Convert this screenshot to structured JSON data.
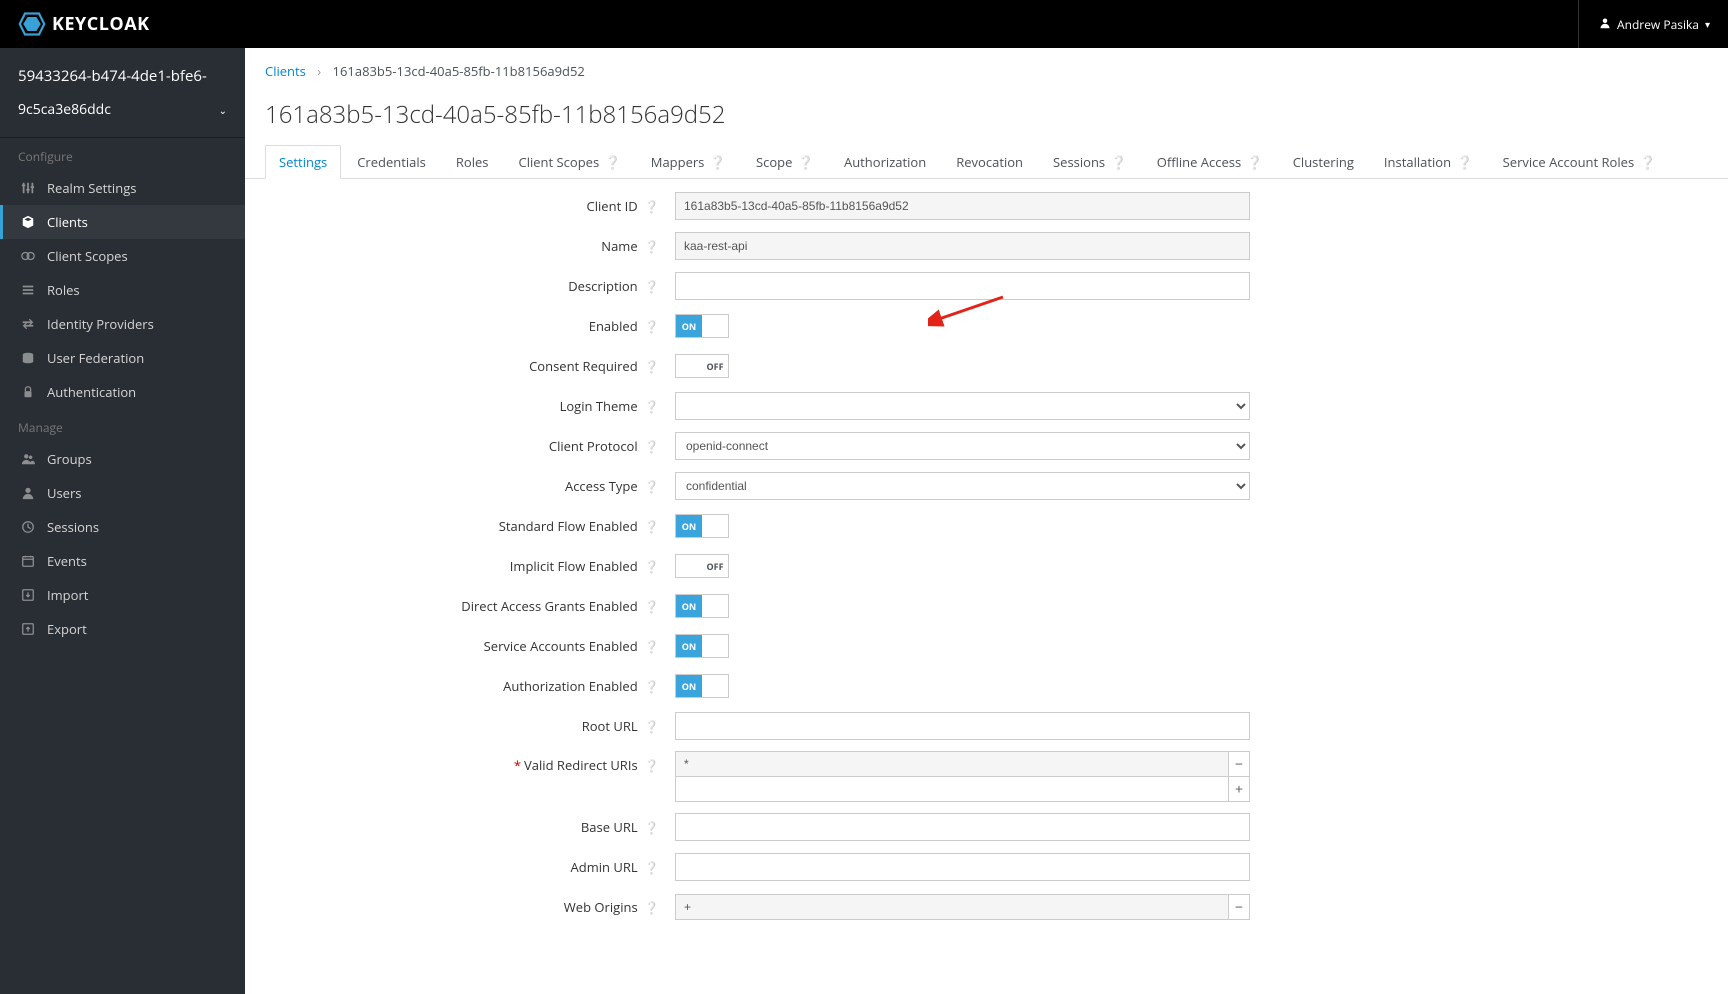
{
  "header": {
    "brand": "KEYCLOAK",
    "user": "Andrew Pasika"
  },
  "sidebar": {
    "realm_line1": "59433264-b474-4de1-bfe6-",
    "realm_selected": "9c5ca3e86ddc",
    "section_configure": "Configure",
    "section_manage": "Manage",
    "configure_items": [
      {
        "label": "Realm Settings"
      },
      {
        "label": "Clients"
      },
      {
        "label": "Client Scopes"
      },
      {
        "label": "Roles"
      },
      {
        "label": "Identity Providers"
      },
      {
        "label": "User Federation"
      },
      {
        "label": "Authentication"
      }
    ],
    "manage_items": [
      {
        "label": "Groups"
      },
      {
        "label": "Users"
      },
      {
        "label": "Sessions"
      },
      {
        "label": "Events"
      },
      {
        "label": "Import"
      },
      {
        "label": "Export"
      }
    ]
  },
  "breadcrumb": {
    "root": "Clients",
    "current": "161a83b5-13cd-40a5-85fb-11b8156a9d52"
  },
  "page_title": "161a83b5-13cd-40a5-85fb-11b8156a9d52",
  "tabs": [
    {
      "label": "Settings",
      "help": false
    },
    {
      "label": "Credentials",
      "help": false
    },
    {
      "label": "Roles",
      "help": false
    },
    {
      "label": "Client Scopes",
      "help": true
    },
    {
      "label": "Mappers",
      "help": true
    },
    {
      "label": "Scope",
      "help": true
    },
    {
      "label": "Authorization",
      "help": false
    },
    {
      "label": "Revocation",
      "help": false
    },
    {
      "label": "Sessions",
      "help": true
    },
    {
      "label": "Offline Access",
      "help": true
    },
    {
      "label": "Clustering",
      "help": false
    },
    {
      "label": "Installation",
      "help": true
    },
    {
      "label": "Service Account Roles",
      "help": true
    }
  ],
  "form": {
    "client_id": {
      "label": "Client ID",
      "value": "161a83b5-13cd-40a5-85fb-11b8156a9d52"
    },
    "name": {
      "label": "Name",
      "value": "kaa-rest-api"
    },
    "description": {
      "label": "Description",
      "value": ""
    },
    "enabled": {
      "label": "Enabled",
      "value": true
    },
    "consent_required": {
      "label": "Consent Required",
      "value": false
    },
    "login_theme": {
      "label": "Login Theme",
      "value": ""
    },
    "client_protocol": {
      "label": "Client Protocol",
      "value": "openid-connect"
    },
    "access_type": {
      "label": "Access Type",
      "value": "confidential"
    },
    "standard_flow": {
      "label": "Standard Flow Enabled",
      "value": true
    },
    "implicit_flow": {
      "label": "Implicit Flow Enabled",
      "value": false
    },
    "direct_access": {
      "label": "Direct Access Grants Enabled",
      "value": true
    },
    "service_accounts": {
      "label": "Service Accounts Enabled",
      "value": true
    },
    "authorization": {
      "label": "Authorization Enabled",
      "value": true
    },
    "root_url": {
      "label": "Root URL",
      "value": ""
    },
    "valid_redirect": {
      "label": "Valid Redirect URIs",
      "value": "*"
    },
    "base_url": {
      "label": "Base URL",
      "value": ""
    },
    "admin_url": {
      "label": "Admin URL",
      "value": ""
    },
    "web_origins": {
      "label": "Web Origins",
      "value": "+"
    },
    "toggle_on": "ON",
    "toggle_off": "OFF"
  }
}
